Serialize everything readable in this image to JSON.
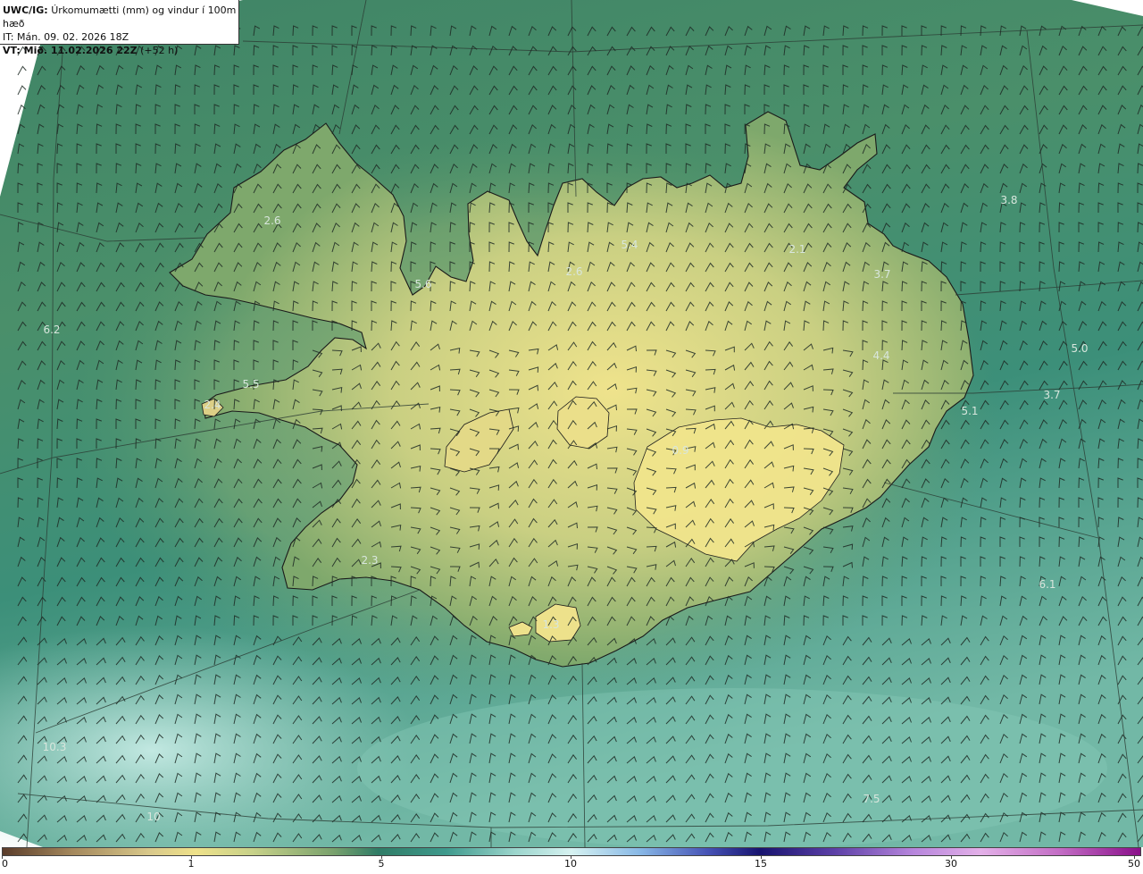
{
  "header": {
    "model_label": "UWC/IG:",
    "title": "Úrkomumætti (mm) og vindur í 100m hæð",
    "it_line": "IT: Mán. 09. 02. 2026 18Z",
    "vt_label": "VT: Mið. 11.02.2026 22Z",
    "vt_offset": "(+52 h)"
  },
  "colors": {
    "land_high": "#e8dc8a",
    "ocean_dark": "#2f7c66",
    "ocean_light": "#9bd5cc",
    "coastline": "#1a1a1a",
    "grid_lines": "#2b3b33",
    "wind_barbs": "#1e2a24"
  },
  "values": [
    {
      "text": "3.8"
    },
    {
      "text": "2.6"
    },
    {
      "text": "5.4"
    },
    {
      "text": "2.1"
    },
    {
      "text": "5.6"
    },
    {
      "text": "2.6"
    },
    {
      "text": "3.7"
    },
    {
      "text": "6.2"
    },
    {
      "text": "5.0"
    },
    {
      "text": "4.4"
    },
    {
      "text": "5.5"
    },
    {
      "text": "3.7"
    },
    {
      "text": "2.4"
    },
    {
      "text": "5.1"
    },
    {
      "text": "0.9"
    },
    {
      "text": "2.3"
    },
    {
      "text": "6.1"
    },
    {
      "text": "1.3"
    },
    {
      "text": "10.3"
    },
    {
      "text": "7.5"
    },
    {
      "text": "10"
    }
  ],
  "colorbar": {
    "ticks": [
      "0",
      "1",
      "5",
      "10",
      "15",
      "30",
      "50"
    ]
  }
}
